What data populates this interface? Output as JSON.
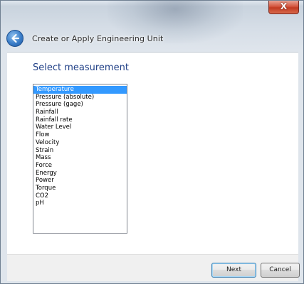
{
  "window": {
    "title": "Create or Apply Engineering Unit",
    "close_label": "X"
  },
  "page": {
    "heading": "Select measurement"
  },
  "measurements": {
    "selected_index": 0,
    "items": [
      "Temperature",
      "Pressure (absolute)",
      "Pressure (gage)",
      "Rainfall",
      "Rainfall rate",
      "Water Level",
      "Flow",
      "Velocity",
      "Strain",
      "Mass",
      "Force",
      "Energy",
      "Power",
      "Torque",
      "CO2",
      "pH"
    ]
  },
  "footer": {
    "next_label": "Next",
    "cancel_label": "Cancel"
  },
  "colors": {
    "selection": "#3399ff",
    "heading": "#1f3f86",
    "close_button": "#c13b22"
  },
  "icons": {
    "back": "back-arrow-icon",
    "close": "close-icon"
  }
}
